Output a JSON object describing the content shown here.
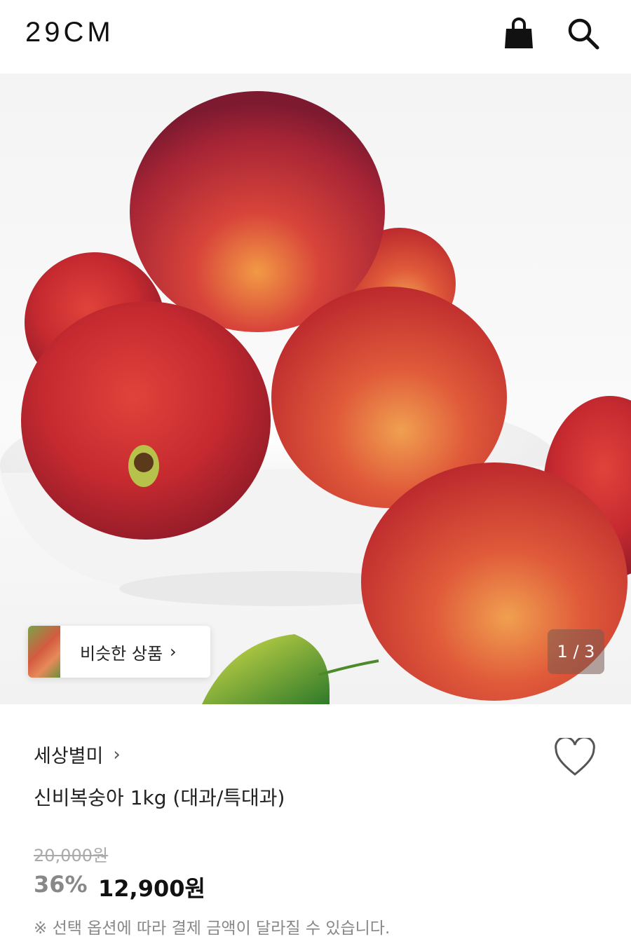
{
  "header": {
    "logo": "29CM",
    "icons": [
      "shopping-bag-icon",
      "search-icon"
    ]
  },
  "gallery": {
    "similar_label": "비슷한 상품",
    "similar_chevron": "›",
    "counter": "1 / 3"
  },
  "product": {
    "brand": "세상별미",
    "brand_chevron": "›",
    "title": "신비복숭아 1kg (대과/특대과)",
    "original_price": "20,000원",
    "discount": "36%",
    "price": "12,900원",
    "note": "※ 선택 옵션에 따라 결제 금액이 달라질 수 있습니다."
  },
  "colors": {
    "text": "#222222",
    "muted": "#888888",
    "accent_peach": "#d8393a"
  }
}
